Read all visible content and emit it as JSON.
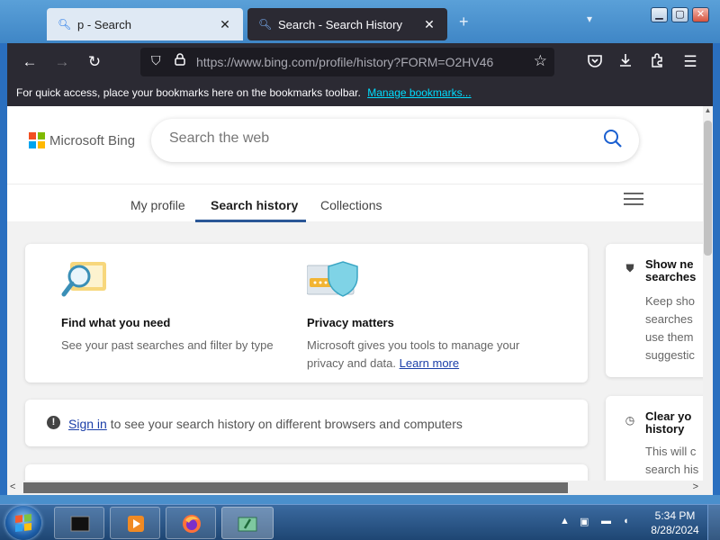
{
  "tabs": [
    {
      "title": "p - Search",
      "favicon": "search-icon"
    },
    {
      "title": "Search - Search History",
      "favicon": "search-icon"
    }
  ],
  "window_controls": {
    "minimize": "▭",
    "maximize": "▢",
    "close": "✕"
  },
  "nav": {
    "url": "https://www.bing.com/profile/history?FORM=O2HV46",
    "back": "←",
    "forward": "→",
    "reload": "↻"
  },
  "bookmarks_bar": {
    "message": "For quick access, place your bookmarks here on the bookmarks toolbar.",
    "link": "Manage bookmarks..."
  },
  "page": {
    "brand": "Microsoft Bing",
    "search_placeholder": "Search the web",
    "profile_tabs": [
      "My profile",
      "Search history",
      "Collections"
    ],
    "features": [
      {
        "title": "Find what you need",
        "text": "See your past searches and filter by type"
      },
      {
        "title": "Privacy matters",
        "text": "Microsoft gives you tools to manage your privacy and data.",
        "link": "Learn more"
      }
    ],
    "signin": {
      "link": "Sign in",
      "text": " to see your search history on different browsers and computers"
    },
    "side_cards": [
      {
        "title": "Show ne\nsearches",
        "text": "Keep sho\nsearches\nuse them\nsuggestic"
      },
      {
        "title": "Clear yo\nhistory",
        "text": "This will c\nsearch his"
      }
    ]
  },
  "taskbar": {
    "time": "5:34 PM",
    "date": "8/28/2024"
  },
  "colors": {
    "accent": "#2b5797",
    "link": "#1a3ea8",
    "browser_chrome": "#2b2a33"
  }
}
